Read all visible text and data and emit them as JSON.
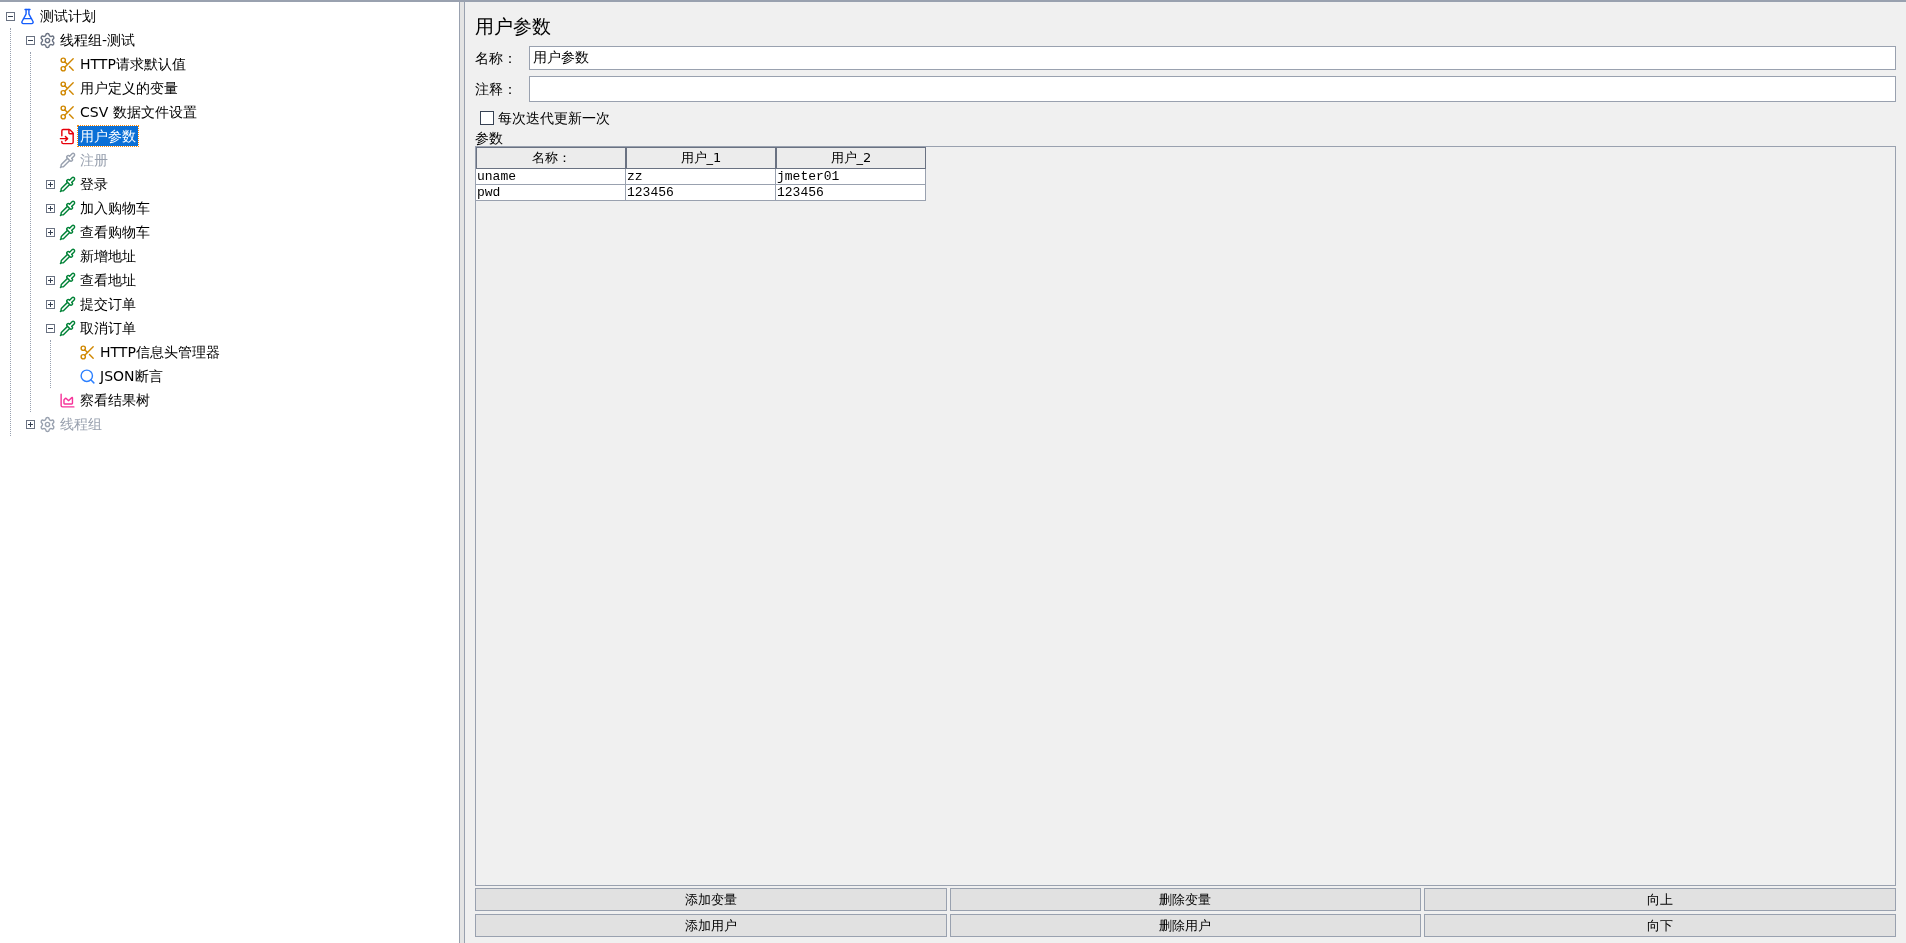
{
  "tree": [
    {
      "label": "测试计划",
      "kind": "plan",
      "expanded": true,
      "selected": false,
      "disabled": false,
      "children": [
        {
          "label": "线程组-测试",
          "kind": "threadgroup",
          "expanded": true,
          "selected": false,
          "disabled": false,
          "children": [
            {
              "label": "HTTP请求默认值",
              "kind": "config",
              "selected": false,
              "disabled": false
            },
            {
              "label": "用户定义的变量",
              "kind": "config",
              "selected": false,
              "disabled": false
            },
            {
              "label": "CSV 数据文件设置",
              "kind": "config",
              "selected": false,
              "disabled": false
            },
            {
              "label": "用户参数",
              "kind": "preprocessor",
              "selected": true,
              "disabled": false
            },
            {
              "label": "注册",
              "kind": "sampler",
              "selected": false,
              "disabled": true
            },
            {
              "label": "登录",
              "kind": "sampler",
              "expanded": false,
              "selected": false,
              "disabled": false
            },
            {
              "label": "加入购物车",
              "kind": "sampler",
              "expanded": false,
              "selected": false,
              "disabled": false
            },
            {
              "label": "查看购物车",
              "kind": "sampler",
              "expanded": false,
              "selected": false,
              "disabled": false
            },
            {
              "label": "新增地址",
              "kind": "sampler",
              "selected": false,
              "disabled": false
            },
            {
              "label": "查看地址",
              "kind": "sampler",
              "expanded": false,
              "selected": false,
              "disabled": false
            },
            {
              "label": "提交订单",
              "kind": "sampler",
              "expanded": false,
              "selected": false,
              "disabled": false
            },
            {
              "label": "取消订单",
              "kind": "sampler",
              "expanded": true,
              "selected": false,
              "disabled": false,
              "children": [
                {
                  "label": "HTTP信息头管理器",
                  "kind": "config",
                  "selected": false,
                  "disabled": false
                },
                {
                  "label": "JSON断言",
                  "kind": "assertion",
                  "selected": false,
                  "disabled": false
                }
              ]
            },
            {
              "label": "察看结果树",
              "kind": "listener",
              "selected": false,
              "disabled": false
            }
          ]
        },
        {
          "label": "线程组",
          "kind": "threadgroup",
          "expanded": false,
          "selected": false,
          "disabled": true
        }
      ]
    }
  ],
  "panel": {
    "title": "用户参数",
    "name_label": "名称：",
    "name_value": "用户参数",
    "comment_label": "注释：",
    "checkbox": {
      "label": "每次迭代更新一次",
      "checked": false
    },
    "section_label": "参数",
    "table": {
      "columns": [
        "名称：",
        "用户_1",
        "用户_2"
      ],
      "rows": [
        [
          "uname",
          "zz",
          "jmeter01"
        ],
        [
          "pwd",
          "123456",
          "123456"
        ]
      ]
    },
    "buttons": [
      [
        "添加变量",
        "删除变量",
        "向上"
      ],
      [
        "添加用户",
        "删除用户",
        "向下"
      ]
    ]
  }
}
